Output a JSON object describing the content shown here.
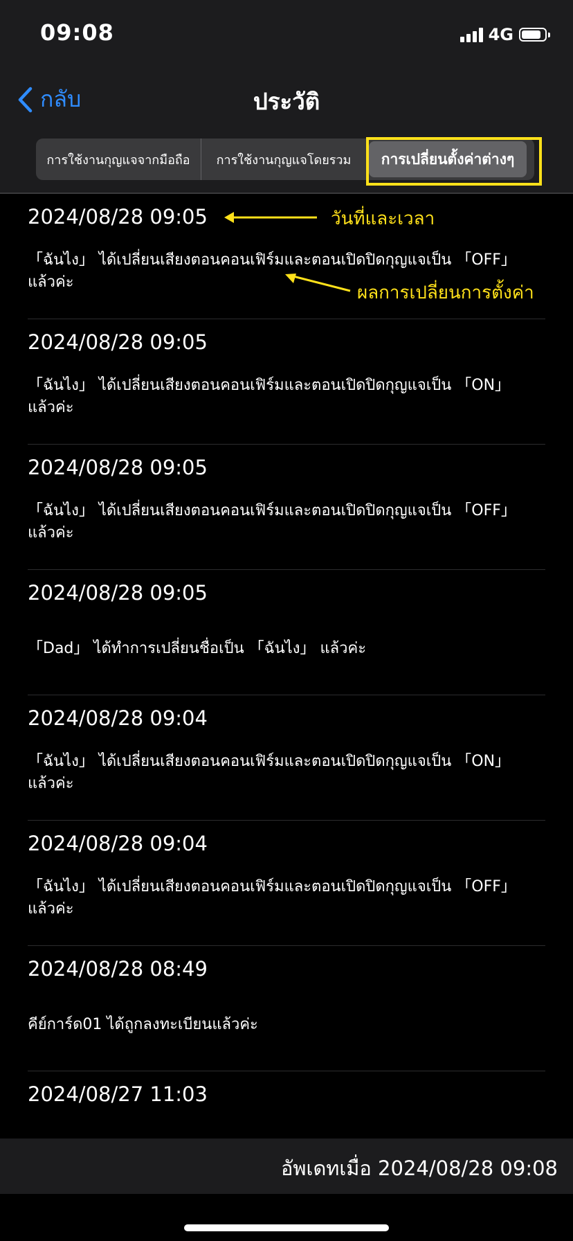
{
  "status_bar": {
    "time": "09:08",
    "network": "4G",
    "battery_level": 0.85
  },
  "nav": {
    "back_label": "กลับ",
    "title": "ประวัติ"
  },
  "tabs": [
    {
      "label": "การใช้งานกุญแจจากมือถือ",
      "selected": false
    },
    {
      "label": "การใช้งานกุญแจโดยรวม",
      "selected": false
    },
    {
      "label": "การเปลี่ยนตั้งค่าต่างๆ",
      "selected": true
    }
  ],
  "annotations": {
    "datetime": "วันที่และเวลา",
    "result": "ผลการเปลี่ยนการตั้งค่า"
  },
  "history": [
    {
      "datetime": "2024/08/28 09:05",
      "line1": "「ฉันไง」 ได้เปลี่ยนเสียงตอนคอนเฟิร์มและตอนเปิดปิดกุญแจเป็น 「OFF」",
      "line2": "แล้วค่ะ"
    },
    {
      "datetime": "2024/08/28 09:05",
      "line1": "「ฉันไง」 ได้เปลี่ยนเสียงตอนคอนเฟิร์มและตอนเปิดปิดกุญแจเป็น 「ON」",
      "line2": "แล้วค่ะ"
    },
    {
      "datetime": "2024/08/28 09:05",
      "line1": "「ฉันไง」 ได้เปลี่ยนเสียงตอนคอนเฟิร์มและตอนเปิดปิดกุญแจเป็น 「OFF」",
      "line2": "แล้วค่ะ"
    },
    {
      "datetime": "2024/08/28 09:05",
      "line1": "「Dad」 ได้ทำการเปลี่ยนชื่อเป็น 「ฉันไง」 แล้วค่ะ"
    },
    {
      "datetime": "2024/08/28 09:04",
      "line1": "「ฉันไง」 ได้เปลี่ยนเสียงตอนคอนเฟิร์มและตอนเปิดปิดกุญแจเป็น 「ON」",
      "line2": "แล้วค่ะ"
    },
    {
      "datetime": "2024/08/28 09:04",
      "line1": "「ฉันไง」 ได้เปลี่ยนเสียงตอนคอนเฟิร์มและตอนเปิดปิดกุญแจเป็น 「OFF」",
      "line2": "แล้วค่ะ"
    },
    {
      "datetime": "2024/08/28 08:49",
      "line1": "คีย์การ์ด01 ได้ถูกลงทะเบียนแล้วค่ะ"
    },
    {
      "datetime": "2024/08/27 11:03"
    }
  ],
  "footer": {
    "updated": "อัพเดทเมื่อ 2024/08/28 09:08"
  },
  "colors": {
    "accent": "#2f8cff",
    "annotation": "#ffe11a",
    "bar_bg": "#1c1c1e"
  }
}
